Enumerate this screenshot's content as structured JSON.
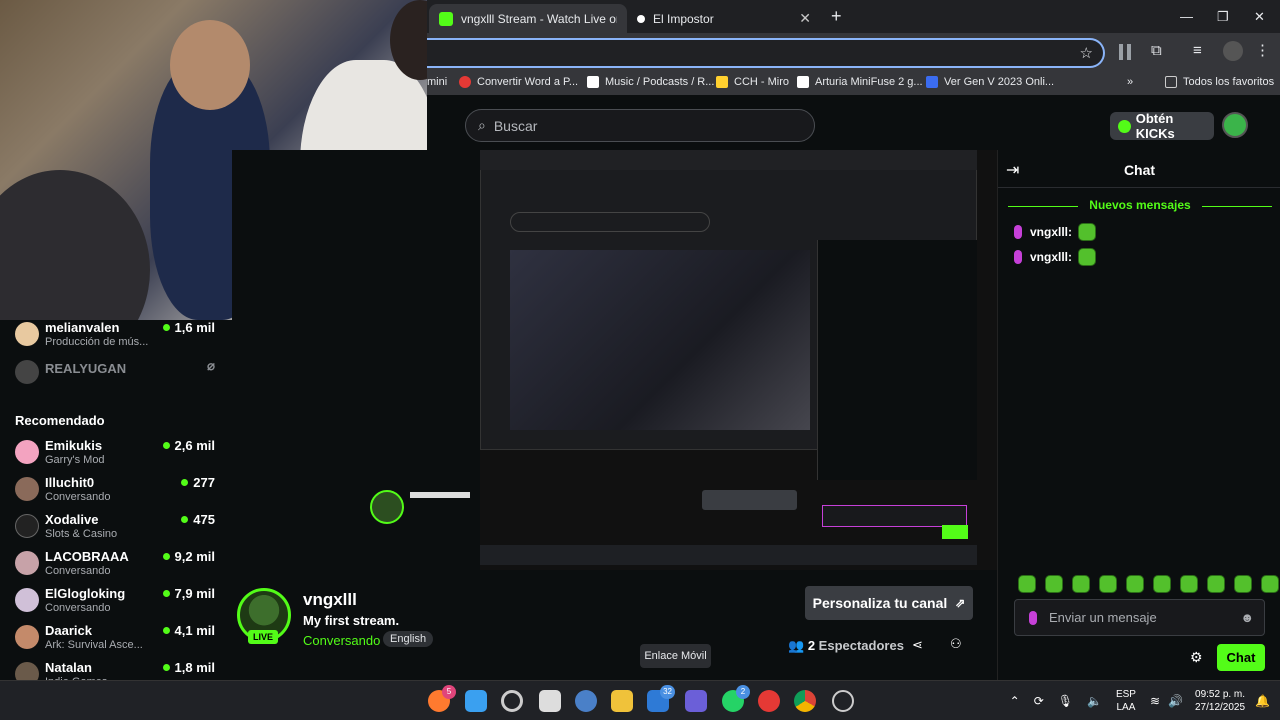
{
  "browser": {
    "tabs": [
      {
        "label": "vngxlll Stream - Watch Live on K",
        "active": true
      },
      {
        "label": "El Impostor",
        "active": false
      }
    ],
    "new_tab": "+",
    "bookmarks": [
      {
        "label": "mini"
      },
      {
        "label": "Convertir Word a P..."
      },
      {
        "label": "Music / Podcasts / R..."
      },
      {
        "label": "CCH - Miro"
      },
      {
        "label": "Arturia MiniFuse 2 g..."
      },
      {
        "label": "Ver Gen V 2023 Onli..."
      },
      {
        "label": "Todos los favoritos"
      }
    ],
    "more": "»"
  },
  "kick": {
    "search_placeholder": "Buscar",
    "get_kicks": "Obtén KICKs",
    "accent": "#53fc18"
  },
  "sidebar": {
    "top_items": [
      {
        "name": "melianvalen",
        "sub": "Producción de mús...",
        "count": "1,6 mil"
      },
      {
        "name": "REALYUGAN",
        "sub": "",
        "count": ""
      }
    ],
    "recommended_title": "Recomendado",
    "recommended": [
      {
        "name": "Emikukis",
        "sub": "Garry's Mod",
        "count": "2,6 mil"
      },
      {
        "name": "Illuchit0",
        "sub": "Conversando",
        "count": "277"
      },
      {
        "name": "Xodalive",
        "sub": "Slots & Casino",
        "count": "475"
      },
      {
        "name": "LACOBRAAA",
        "sub": "Conversando",
        "count": "9,2 mil"
      },
      {
        "name": "ElGlogloking",
        "sub": "Conversando",
        "count": "7,9 mil"
      },
      {
        "name": "Daarick",
        "sub": "Ark: Survival Asce...",
        "count": "4,1 mil"
      },
      {
        "name": "Natalan",
        "sub": "Indie Games",
        "count": "1,8 mil"
      }
    ]
  },
  "chat": {
    "title": "Chat",
    "new_messages": "Nuevos mensajes",
    "messages": [
      {
        "user": "vngxlll:"
      },
      {
        "user": "vngxlll:"
      }
    ],
    "input_placeholder": "Enviar un mensaje",
    "send_label": "Chat"
  },
  "stream": {
    "streamer": "vngxlll",
    "live": "LIVE",
    "title": "My first stream.",
    "category": "Conversando",
    "language": "English",
    "customize": "Personaliza tu canal",
    "viewers_count": "2",
    "viewers_label": "Espectadores"
  },
  "tooltip": "Enlace Móvil",
  "taskbar": {
    "badges": {
      "firefox": "5",
      "mail": "32",
      "whatsapp": "2"
    },
    "lang": "ESP",
    "lang2": "LAA",
    "time": "09:52 p. m.",
    "date": "27/12/2025"
  }
}
